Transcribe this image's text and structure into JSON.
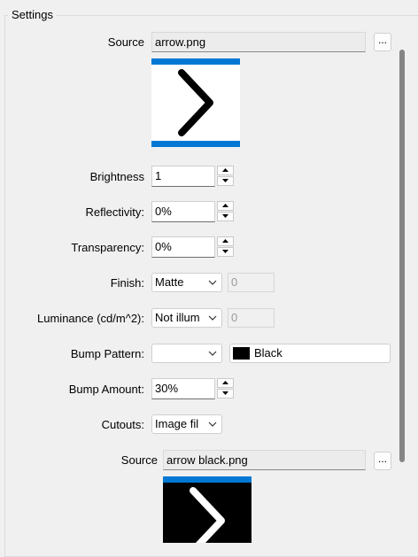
{
  "group_title": "Settings",
  "source1": {
    "label": "Source",
    "value": "arrow.png",
    "browse_label": "..."
  },
  "brightness": {
    "label": "Brightness",
    "value": "1"
  },
  "reflectivity": {
    "label": "Reflectivity:",
    "value": "0%"
  },
  "transparency": {
    "label": "Transparency:",
    "value": "0%"
  },
  "finish": {
    "label": "Finish:",
    "value": "Matte",
    "extra_value": "0"
  },
  "luminance": {
    "label": "Luminance (cd/m^2):",
    "value": "Not illum",
    "extra_value": "0"
  },
  "bump_pattern": {
    "label": "Bump Pattern:",
    "value": "",
    "color_name": "Black",
    "color_hex": "#000000"
  },
  "bump_amount": {
    "label": "Bump Amount:",
    "value": "30%"
  },
  "cutouts": {
    "label": "Cutouts:",
    "value": "Image fil"
  },
  "source2": {
    "label": "Source",
    "value": "arrow black.png",
    "browse_label": "..."
  },
  "colors": {
    "accent_blue": "#0078d4",
    "background": "#f0f0f0"
  },
  "icons": {
    "spin_up": "arrow-up-icon",
    "spin_down": "arrow-down-icon",
    "dropdown": "chevron-down-icon",
    "preview1": "chevron-right-icon",
    "preview2": "chevron-right-icon"
  }
}
